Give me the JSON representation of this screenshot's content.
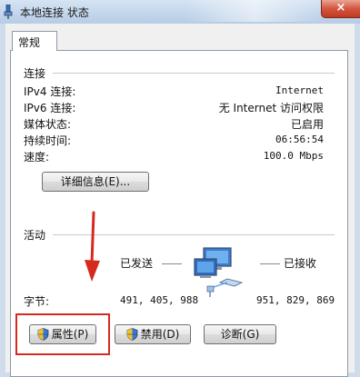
{
  "window": {
    "title": "本地连接 状态",
    "close_label": "×"
  },
  "tab": {
    "label": "常规"
  },
  "connection": {
    "heading": "连接",
    "rows": [
      {
        "label": "IPv4 连接:",
        "value": "Internet"
      },
      {
        "label": "IPv6 连接:",
        "value": "无 Internet 访问权限"
      },
      {
        "label": "媒体状态:",
        "value": "已启用"
      },
      {
        "label": "持续时间:",
        "value": "06:56:54"
      },
      {
        "label": "速度:",
        "value": "100.0 Mbps"
      }
    ],
    "details_button": "详细信息(E)..."
  },
  "activity": {
    "heading": "活动",
    "sent_label": "已发送",
    "received_label": "已接收",
    "bytes_label": "字节:",
    "bytes_sent": "491, 405, 988",
    "bytes_received": "951, 829, 869"
  },
  "buttons": {
    "properties": "属性(P)",
    "disable": "禁用(D)",
    "diagnose": "诊断(G)"
  },
  "colors": {
    "highlight_box": "#d62a1e",
    "arrow": "#d62a1e",
    "titlebar": "#c2d5eb"
  }
}
